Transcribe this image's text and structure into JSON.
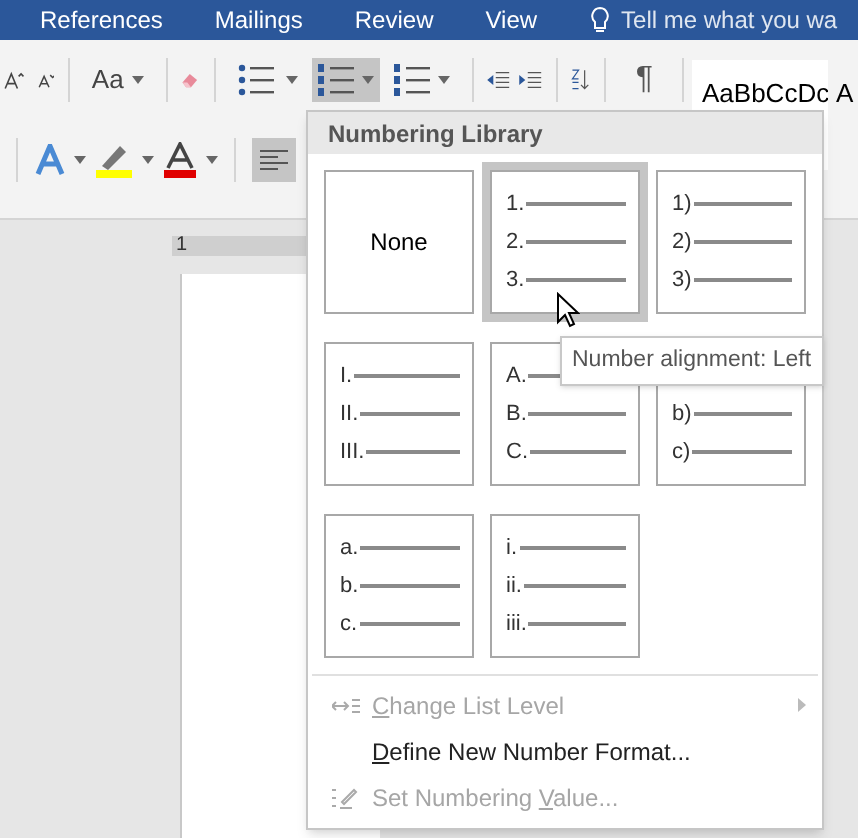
{
  "tabs": [
    {
      "label": "References"
    },
    {
      "label": "Mailings"
    },
    {
      "label": "Review"
    },
    {
      "label": "View"
    }
  ],
  "tell_me": {
    "placeholder": "Tell me what you wa"
  },
  "ribbon": {
    "change_case": "Aa",
    "pilcrow": "¶",
    "numbering_selected": true,
    "align_left_selected": true,
    "style_preview": "AaBbCcDc",
    "style_preview_next": "A"
  },
  "ruler": {
    "label": "1"
  },
  "numbering_menu": {
    "title": "Numbering Library",
    "cells": [
      {
        "kind": "none",
        "label": "None",
        "selected": false
      },
      {
        "kind": "list",
        "markers": [
          "1.",
          "2.",
          "3."
        ],
        "selected": true
      },
      {
        "kind": "list",
        "markers": [
          "1)",
          "2)",
          "3)"
        ],
        "selected": false
      },
      {
        "kind": "list",
        "markers": [
          "I.",
          "II.",
          "III."
        ],
        "selected": false
      },
      {
        "kind": "list",
        "markers": [
          "A.",
          "B.",
          "C."
        ],
        "selected": false
      },
      {
        "kind": "list",
        "markers": [
          "b)",
          "c)"
        ],
        "first_row_covered": true,
        "selected": false
      },
      {
        "kind": "list",
        "markers": [
          "a.",
          "b.",
          "c."
        ],
        "selected": false
      },
      {
        "kind": "list",
        "markers": [
          "i.",
          "ii.",
          "iii."
        ],
        "selected": false
      }
    ],
    "items": [
      {
        "kind": "change_level",
        "key": "C",
        "after": "hange List Level",
        "disabled": true,
        "submenu": true
      },
      {
        "kind": "define",
        "key": "D",
        "after": "efine New Number Format...",
        "disabled": false,
        "submenu": false
      },
      {
        "kind": "set_value",
        "before": "Set Numbering ",
        "key": "V",
        "after": "alue...",
        "disabled": true,
        "submenu": false
      }
    ]
  },
  "tooltip": {
    "text": "Number alignment: Left"
  }
}
